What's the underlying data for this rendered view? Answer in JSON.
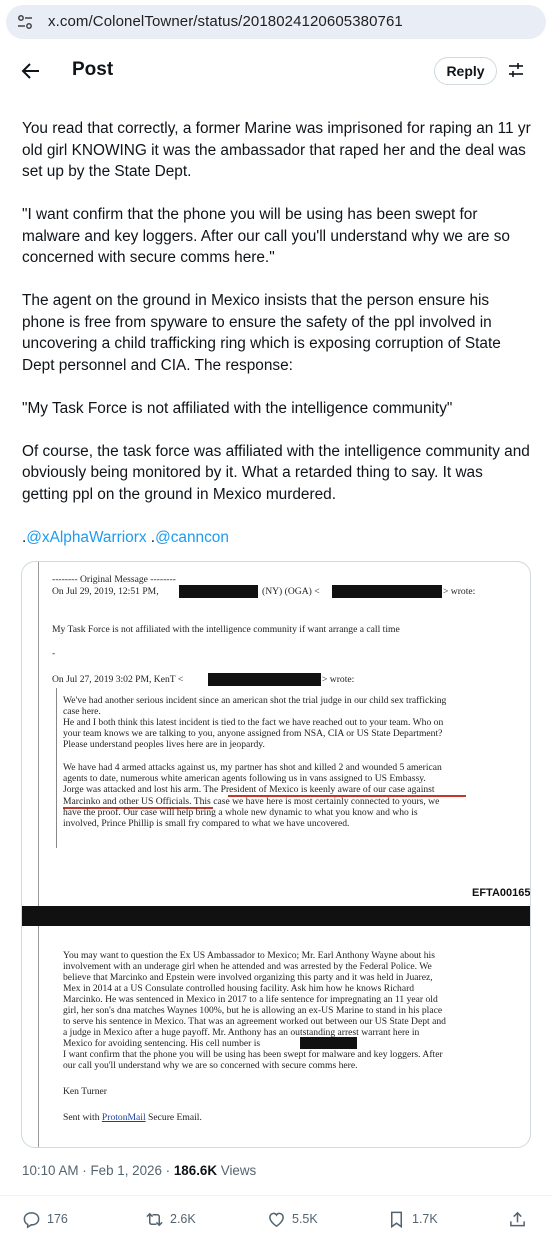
{
  "browser": {
    "url": "x.com/ColonelTowner/status/2018024120605380761"
  },
  "header": {
    "title": "Post",
    "reply_label": "Reply"
  },
  "post": {
    "paragraphs": [
      "You read that correctly, a former Marine was imprisoned for raping an 11 yr old girl KNOWING it was the ambassador that raped her and the deal was set up by the State Dept.",
      "\"I want confirm that the phone you will be using has been swept for malware and key loggers. After our call you'll understand why we are so concerned with secure comms here.\"",
      "The agent on the ground in Mexico insists that the person ensure his phone is free from spyware to ensure the safety of the ppl involved in uncovering a child trafficking ring which is exposing corruption of State Dept personnel and CIA. The response:",
      "\"My Task Force is not affiliated with the intelligence community\"",
      "Of course, the task force was affiliated with the intelligence community and obviously being monitored by it. What a retarded thing to say. It was getting ppl on the ground in Mexico murdered."
    ],
    "mention_prefix1": ".",
    "mention1": "@xAlphaWarriorx",
    "mention_prefix2": " .",
    "mention2": "@canncon"
  },
  "document": {
    "original_message": "-------- Original Message --------",
    "on_line1a": "On Jul 29, 2019, 12:51 PM,",
    "on_line1b": "(NY) (OGA) <",
    "on_line1c": "> wrote:",
    "task_force": "My Task Force is not affiliated with the intelligence community if want arrange a call time",
    "dash": "-",
    "on_line2a": "On Jul 27, 2019 3:02 PM, KenT <",
    "on_line2b": "> wrote:",
    "p1": [
      "We've had another serious incident since an american shot the trial judge in our child sex trafficking",
      "case here.",
      "He and I both think this latest incident is tied to the fact we have reached out to your team.  Who on",
      "your team knows we are talking to you, anyone assigned from NSA, CIA or US State Department?",
      "Please understand peoples lives here are in jeopardy."
    ],
    "p2": [
      "We have had 4 armed attacks against us, my partner has shot and killed 2 and wounded 5 american",
      "agents to date, numerous white american agents following us in vans assigned to US Embassy.",
      "Jorge was attacked and lost his arm.  The President of Mexico is keenly aware of our case against",
      "Marcinko and other US Officials.  This case we have here is most certainly connected to yours, we",
      "have the proof.  Our case will help bring a whole new dynamic to what you know and who is",
      "involved, Prince Phillip is small fry compared to what we have uncovered."
    ],
    "efta": "EFTA00165",
    "p3": [
      "You may want to question the Ex US Ambassador to Mexico; Mr. Earl Anthony Wayne about his",
      "involvement with an underage girl when he attended and was arrested by the Federal Police.  We",
      "believe that Marcinko and Epstein were involved organizing this party and it was held in Juarez,",
      "Mex in 2014 at a US Consulate controlled housing facility.  Ask him how he knows Richard",
      "Marcinko.  He was sentenced in Mexico in 2017 to a life sentence for impregnating an 11 year old",
      "girl, her son's dna matches Waynes 100%, but  he is allowing an ex-US Marine to stand in his place",
      "to serve his sentence in Mexico.  That was an agreement worked out between our US State Dept and",
      "a judge in Mexico after a huge payoff.  Mr. Anthony has an outstanding arrest warrant here in",
      "Mexico for avoiding sentencing.  His cell number is",
      "I want confirm that the phone you will be using has been swept for malware and key loggers.  After",
      "our call you'll understand why we are so concerned with secure comms here."
    ],
    "signature": "Ken Turner",
    "sent_with": "Sent with ",
    "protonmail": "ProtonMail",
    "secure_email": " Secure Email."
  },
  "meta": {
    "time": "10:10 AM · Feb 1, 2026 · ",
    "views_count": "186.6K",
    "views_label": " Views"
  },
  "actions": {
    "replies": "176",
    "reposts": "2.6K",
    "likes": "5.5K",
    "bookmarks": "1.7K"
  },
  "colors": {
    "accent": "#1d9bf0",
    "text": "#0f1419",
    "muted": "#536471",
    "underline": "#c0392b"
  }
}
